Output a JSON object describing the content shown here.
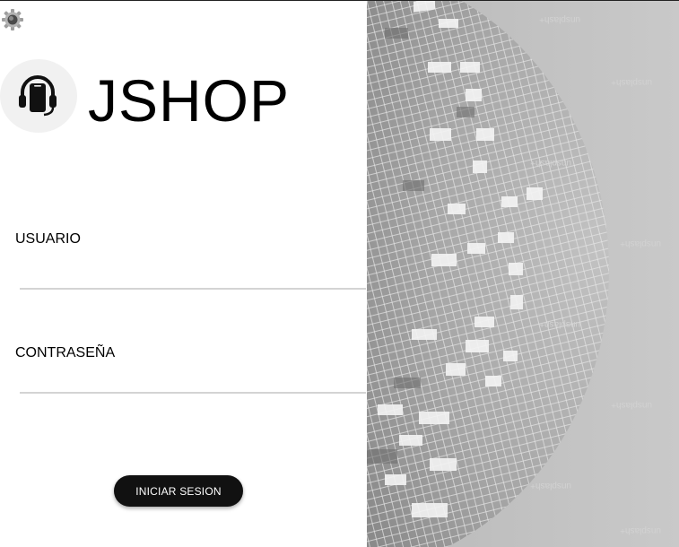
{
  "app": {
    "brand": "JSHOP",
    "logo_icon": "headset-phone-icon",
    "settings_icon": "gear-icon"
  },
  "form": {
    "username_label": "USUARIO",
    "username_value": "",
    "password_label": "CONTRASEÑA",
    "password_value": "",
    "login_button": "INICIAR SESION"
  },
  "hero": {
    "image": "mirror-disco-ball-photo",
    "watermark": "unsplash+"
  },
  "colors": {
    "button_bg": "#111111",
    "button_text": "#ffffff",
    "input_underline": "#d4d4d4",
    "logo_badge_bg": "#f1f1f1"
  }
}
